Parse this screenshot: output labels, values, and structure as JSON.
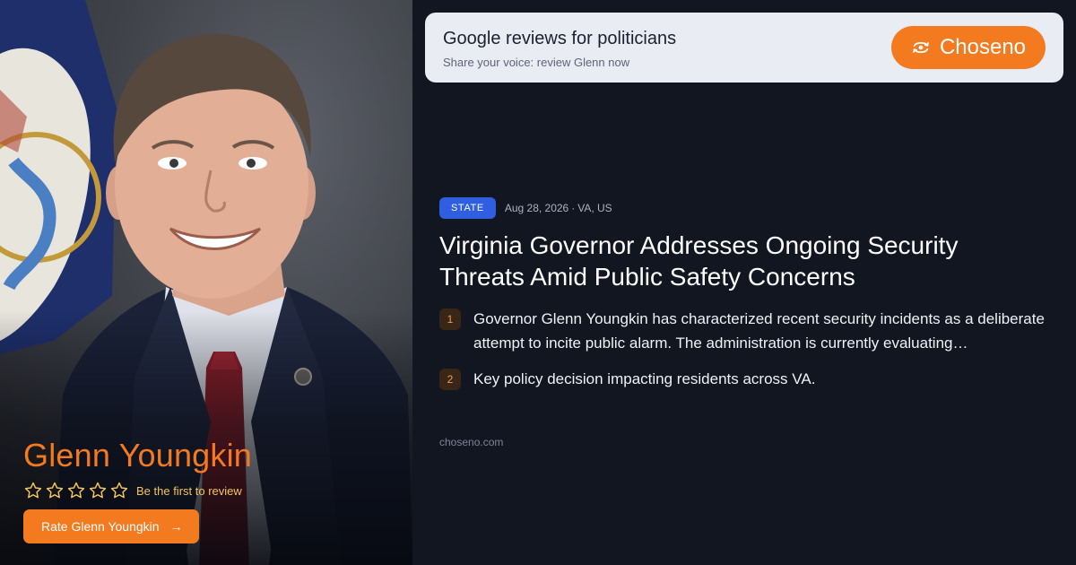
{
  "person": {
    "name": "Glenn Youngkin",
    "stars_filled": 0,
    "stars_total": 5,
    "rating_prompt": "Be the first to review",
    "rate_button_label": "Rate Glenn Youngkin",
    "rate_button_icon": "arrow-right-icon"
  },
  "banner": {
    "title": "Google reviews for politicians",
    "subtitle": "Share your voice: review Glenn now",
    "brand_label": "Choseno",
    "brand_icon": "eye-rotate-icon"
  },
  "article": {
    "category": "STATE",
    "date": "Aug 28, 2026",
    "separator": "·",
    "location": "VA, US",
    "headline": "Virginia Governor Addresses Ongoing Security Threats Amid Public Safety Concerns",
    "points": [
      {
        "number": "1",
        "text": "Governor Glenn Youngkin has characterized recent security incidents as a deliberate attempt to incite public alarm. The administration is currently evaluating…"
      },
      {
        "number": "2",
        "text": "Key policy decision impacting residents across VA."
      }
    ],
    "source": "choseno.com"
  },
  "colors": {
    "accent": "#f47a20",
    "badge": "#2f5fe0",
    "background": "#121621",
    "banner": "#e9ecf2",
    "star_outline": "#f4c65a"
  }
}
